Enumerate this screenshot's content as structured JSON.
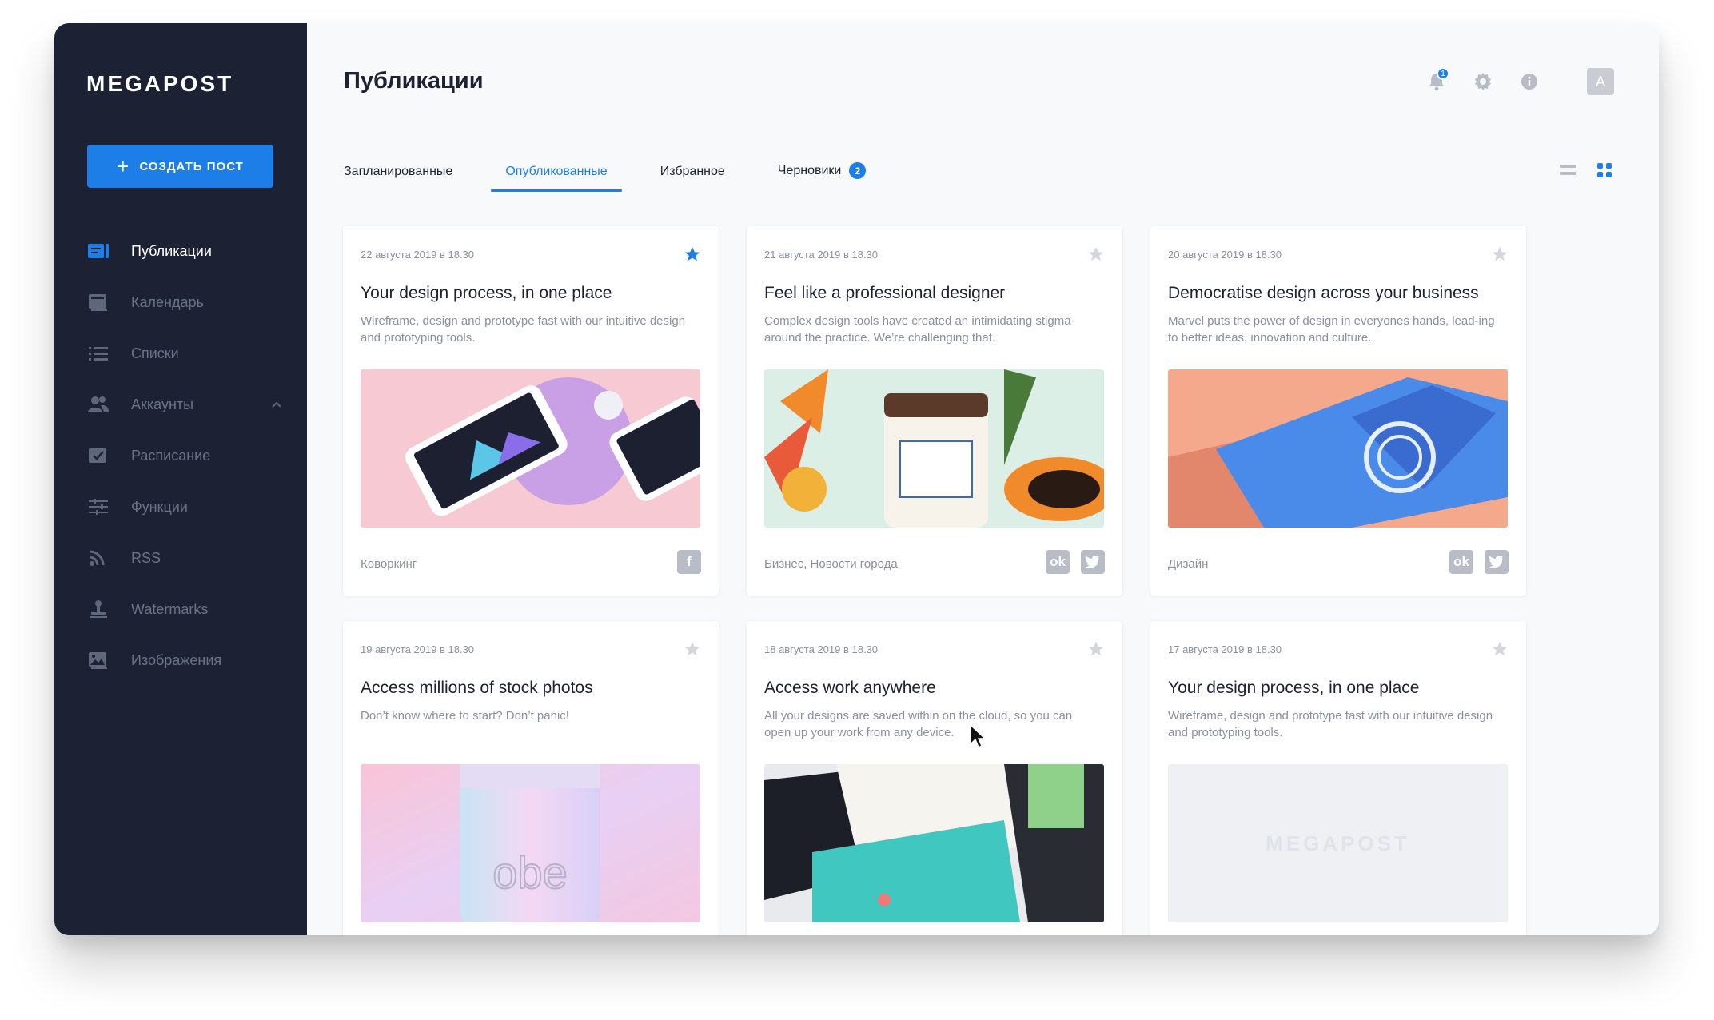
{
  "sidebar": {
    "logo": "MEGAPOST",
    "create_button": "Создать пост",
    "items": [
      {
        "label": "Публикации",
        "icon": "publications-icon",
        "active": true
      },
      {
        "label": "Календарь",
        "icon": "calendar-icon"
      },
      {
        "label": "Списки",
        "icon": "list-icon"
      },
      {
        "label": "Аккаунты",
        "icon": "accounts-icon",
        "expandable": true
      },
      {
        "label": "Расписание",
        "icon": "schedule-icon"
      },
      {
        "label": "Функции",
        "icon": "functions-icon"
      },
      {
        "label": "RSS",
        "icon": "rss-icon"
      },
      {
        "label": "Watermarks",
        "icon": "stamp-icon"
      },
      {
        "label": "Изображения",
        "icon": "images-icon"
      }
    ]
  },
  "header": {
    "title": "Публикации",
    "notification_count": "1",
    "avatar_letter": "A"
  },
  "tabs": [
    {
      "label": "Запланированные"
    },
    {
      "label": "Опубликованные",
      "active": true
    },
    {
      "label": "Избранное"
    },
    {
      "label": "Черновики",
      "badge": "2"
    }
  ],
  "cards": [
    {
      "date": "22 августа 2019 в 18.30",
      "starred": true,
      "title": "Your design process, in one place",
      "desc": "Wireframe, design and prototype fast with our intuitive design and prototyping tools.",
      "tags": "Коворкинг",
      "socials": [
        "facebook"
      ]
    },
    {
      "date": "21 августа 2019 в 18.30",
      "starred": false,
      "title": "Feel like a professional designer",
      "desc": "Complex design tools have created an intimidating stigma around the practice. We’re challenging that.",
      "tags": "Бизнес, Новости города",
      "socials": [
        "odnoklassniki",
        "twitter"
      ]
    },
    {
      "date": "20 августа 2019 в 18.30",
      "starred": false,
      "title": "Democratise design across your business",
      "desc": "Marvel puts the power of design in everyones hands, lead-ing to better ideas, innovation and culture.",
      "tags": "Дизайн",
      "socials": [
        "odnoklassniki",
        "twitter"
      ]
    },
    {
      "date": "19 августа 2019 в 18.30",
      "starred": false,
      "title": "Access millions of stock photos",
      "desc": "Don’t know where to start? Don’t panic!",
      "tags": "",
      "socials": []
    },
    {
      "date": "18 августа 2019 в 18.30",
      "starred": false,
      "title": "Access work anywhere",
      "desc": "All your designs are saved within on the cloud, so you can open up your work from any device.",
      "tags": "",
      "socials": []
    },
    {
      "date": "17 августа 2019 в 18.30",
      "starred": false,
      "title": "Your design process, in one place",
      "desc": "Wireframe, design and prototype fast with our intuitive design and prototyping tools.",
      "tags": "",
      "socials": [],
      "placeholder_text": "MEGAPOST"
    }
  ],
  "colors": {
    "accent": "#1e7ee8",
    "sidebar_bg": "#1c2233",
    "star_active": "#1e7ee8",
    "star_inactive": "#d3d6dd"
  }
}
